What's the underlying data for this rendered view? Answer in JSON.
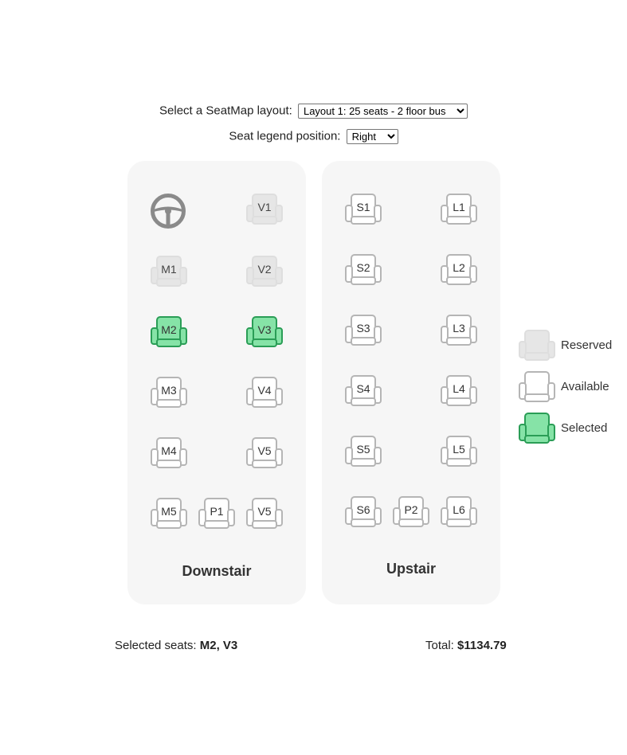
{
  "controls": {
    "layout_label": "Select a SeatMap layout:",
    "layout_selected": "Layout 1: 25 seats - 2 floor bus",
    "legend_label": "Seat legend position:",
    "legend_selected": "Right"
  },
  "decks": {
    "downstair": {
      "title": "Downstair",
      "seats": [
        {
          "id": "V1",
          "status": "reserved"
        },
        {
          "id": "M1",
          "status": "reserved"
        },
        {
          "id": "V2",
          "status": "reserved"
        },
        {
          "id": "M2",
          "status": "selected"
        },
        {
          "id": "V3",
          "status": "selected"
        },
        {
          "id": "M3",
          "status": "available"
        },
        {
          "id": "V4",
          "status": "available"
        },
        {
          "id": "M4",
          "status": "available"
        },
        {
          "id": "V5",
          "status": "available"
        },
        {
          "id": "M5",
          "status": "available"
        },
        {
          "id": "P1",
          "status": "available"
        },
        {
          "id": "V5",
          "status": "available"
        }
      ]
    },
    "upstair": {
      "title": "Upstair",
      "seats": [
        {
          "id": "S1",
          "status": "available"
        },
        {
          "id": "L1",
          "status": "available"
        },
        {
          "id": "S2",
          "status": "available"
        },
        {
          "id": "L2",
          "status": "available"
        },
        {
          "id": "S3",
          "status": "available"
        },
        {
          "id": "L3",
          "status": "available"
        },
        {
          "id": "S4",
          "status": "available"
        },
        {
          "id": "L4",
          "status": "available"
        },
        {
          "id": "S5",
          "status": "available"
        },
        {
          "id": "L5",
          "status": "available"
        },
        {
          "id": "S6",
          "status": "available"
        },
        {
          "id": "P2",
          "status": "available"
        },
        {
          "id": "L6",
          "status": "available"
        }
      ]
    }
  },
  "legend": [
    {
      "status": "reserved",
      "label": "Reserved"
    },
    {
      "status": "available",
      "label": "Available"
    },
    {
      "status": "selected",
      "label": "Selected"
    }
  ],
  "summary": {
    "selected_label": "Selected seats:",
    "selected_value": "M2, V3",
    "total_label": "Total:",
    "total_value": "$1134.79"
  },
  "colors": {
    "reserved_fill": "#e6e6e6",
    "reserved_stroke": "#dedede",
    "available_fill": "#ffffff",
    "available_stroke": "#b5b5b5",
    "selected_fill": "#86e3a7",
    "selected_stroke": "#2a9d56",
    "deck_bg": "#f6f6f6"
  },
  "icons": {
    "driver": "steering-wheel-icon"
  }
}
